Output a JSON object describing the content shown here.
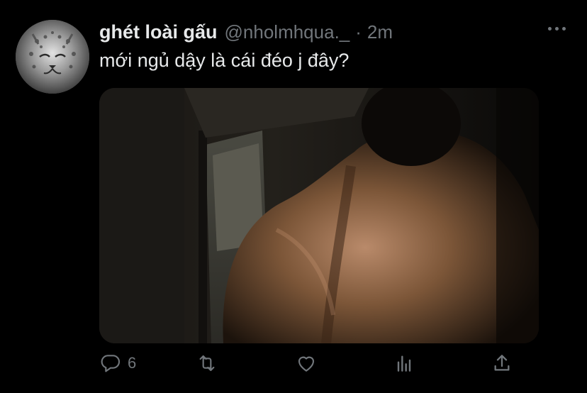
{
  "tweet": {
    "display_name": "ghét loài gấu",
    "handle": "@nholmhqua._",
    "separator": "·",
    "time": "2m",
    "text": "mới ngủ dậy là cái đéo j đây?"
  },
  "actions": {
    "reply_count": "6",
    "retweet_count": "",
    "like_count": ""
  },
  "colors": {
    "background": "#000000",
    "primary_text": "#e7e9ea",
    "secondary_text": "#71767b"
  },
  "icons": [
    "more-icon",
    "reply-icon",
    "retweet-icon",
    "like-icon",
    "analytics-icon",
    "share-icon"
  ]
}
